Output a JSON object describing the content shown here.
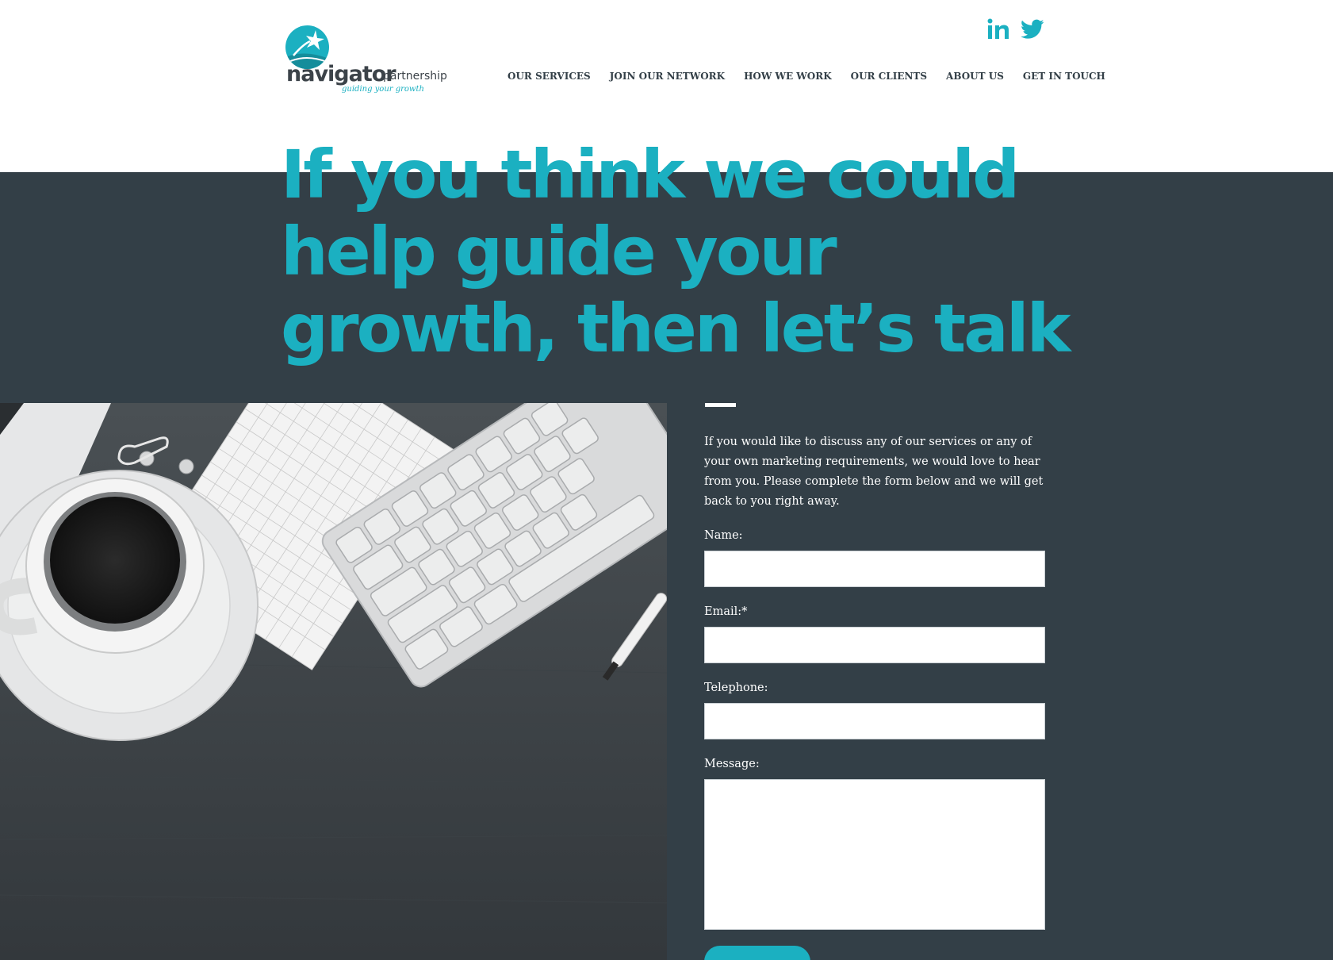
{
  "brand": {
    "name": "navigator",
    "name_suffix": "partnership",
    "tagline": "guiding your growth",
    "accent_color": "#1bb0c1",
    "dark_color": "#333f47"
  },
  "social": [
    {
      "icon": "linkedin-icon"
    },
    {
      "icon": "twitter-icon"
    }
  ],
  "nav": {
    "items": [
      {
        "label": "OUR SERVICES"
      },
      {
        "label": "JOIN OUR NETWORK"
      },
      {
        "label": "HOW WE WORK"
      },
      {
        "label": "OUR CLIENTS"
      },
      {
        "label": "ABOUT US"
      },
      {
        "label": "GET IN TOUCH",
        "active": true
      }
    ]
  },
  "hero": {
    "lines": [
      "If you think we could",
      "help guide your",
      "growth, then let’s talk"
    ]
  },
  "form": {
    "intro": "If you would like to discuss any of our services or any of your own marketing requirements, we would love to hear from you. Please complete the form below and we will get back to you right away.",
    "name_label": "Name:",
    "name_value": "",
    "email_label": "Email:*",
    "email_value": "",
    "telephone_label": "Telephone:",
    "telephone_value": "",
    "message_label": "Message:",
    "message_value": ""
  }
}
